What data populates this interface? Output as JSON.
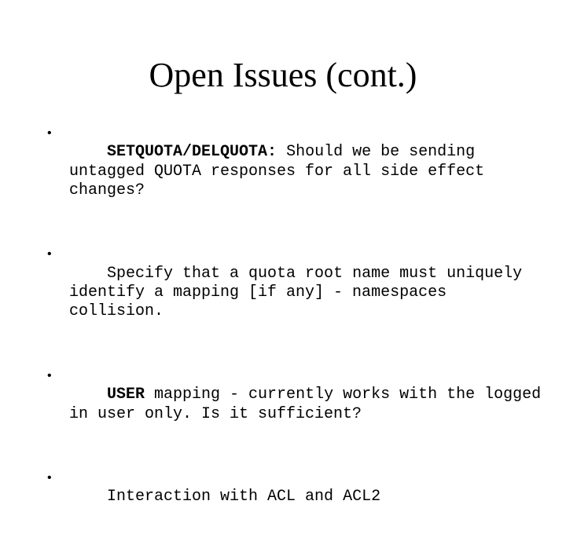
{
  "slide": {
    "title": "Open Issues (cont.)",
    "bullet_glyph": "•",
    "bullets": [
      {
        "bold": "SETQUOTA/DELQUOTA:",
        "text": " Should we be sending\nuntagged QUOTA responses for all side effect\nchanges?"
      },
      {
        "bold": "",
        "text": "Specify that a quota root name must uniquely\nidentify a mapping [if any] - namespaces\ncollision."
      },
      {
        "bold": "USER",
        "text": " mapping - currently works with the logged\nin user only. Is it sufficient?"
      },
      {
        "bold": "",
        "text": "Interaction with ACL and ACL2"
      }
    ]
  }
}
